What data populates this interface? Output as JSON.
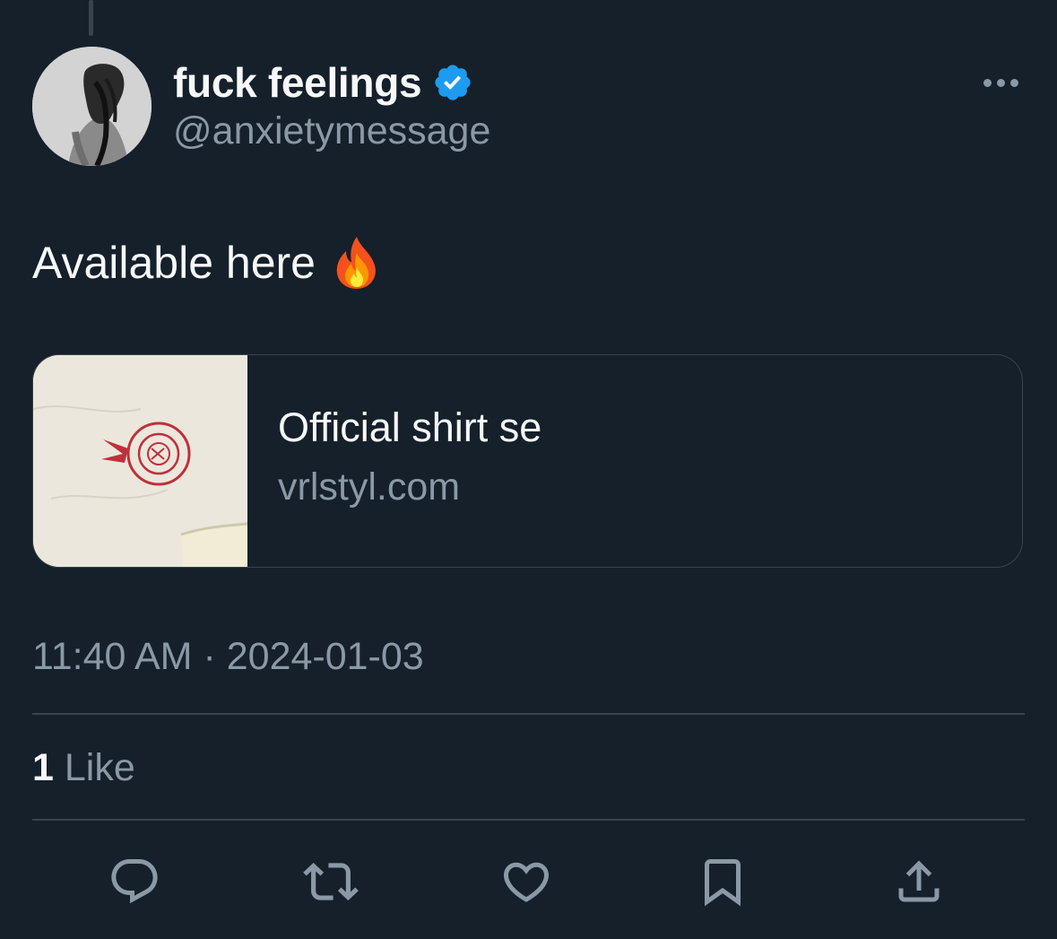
{
  "tweet": {
    "display_name": "fuck feelings",
    "handle": "@anxietymessage",
    "verified": true,
    "text": "Available here",
    "emoji": "fire-emoji",
    "link_card": {
      "title": "Official shirt se",
      "domain": "vrlstyl.com",
      "image_desc_icon": "shirt-thumbnail"
    },
    "time": "11:40 AM",
    "separator": "·",
    "date": "2024-01-03",
    "likes": {
      "count": "1",
      "label": "Like"
    }
  },
  "actions": [
    {
      "name": "reply",
      "icon": "reply-icon"
    },
    {
      "name": "retweet",
      "icon": "retweet-icon"
    },
    {
      "name": "like",
      "icon": "heart-icon"
    },
    {
      "name": "bookmark",
      "icon": "bookmark-icon"
    },
    {
      "name": "share",
      "icon": "share-icon"
    }
  ],
  "colors": {
    "background": "#15202b",
    "text_primary": "#f7f9f9",
    "text_secondary": "#8b98a5",
    "border": "#38444d",
    "verified_blue": "#1d9bf0"
  }
}
